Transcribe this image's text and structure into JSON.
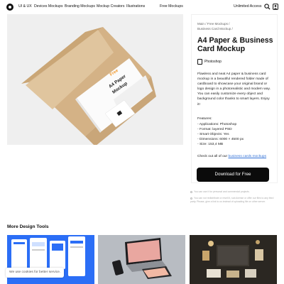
{
  "nav": {
    "links": [
      "UI & UX",
      "Devices Mockups",
      "Branding Mockups",
      "Mockup Creators",
      "Illustrations",
      "Free Mockups"
    ],
    "unlimited_access": "Unlimited Access",
    "logo_icon": "logo-circle-icon",
    "search_icon": "search-icon",
    "user_icon": "user-icon"
  },
  "preview": {
    "cover_line1": "Free",
    "cover_line2": "A4 Paper",
    "cover_line3": "Mockup",
    "accent_color": "#f29a2e",
    "kraft_color": "#d9b98c"
  },
  "product": {
    "breadcrumb": [
      "Main /",
      "Free Mockups /",
      "Business Card Mockup /"
    ],
    "title": "A4 Paper & Business Card Mockup",
    "app_label": "Photoshop",
    "description": "Flawless and neat A4 paper & business card mockup in a beautiful rendered folder made of cardboard to showcase your original brand or logo design in a photorealistic and modern way. You can easily customize every object and background color thanks to smart layers. Enjoy it!",
    "features_title": "Features:",
    "features": [
      "- Applications: Photoshop",
      "- Format: layered PSD",
      "- Smart Objects: Yes",
      "- Dimensions: 6000 × 4500 px",
      "- Size: 153,4 MB"
    ],
    "checkout_text": "Check out all of our",
    "checkout_link": "business cards mockups",
    "download_label": "Download for Free",
    "note1": "You can use it for personal and commercial projects.",
    "note2": "You can not redistribute or resell it, sub-license or offer our files to any third party. Please, give a link to us instead of uploading file on other server."
  },
  "more": {
    "title": "More Design Tools"
  },
  "cookie": {
    "text": "We use cookies for better service."
  }
}
